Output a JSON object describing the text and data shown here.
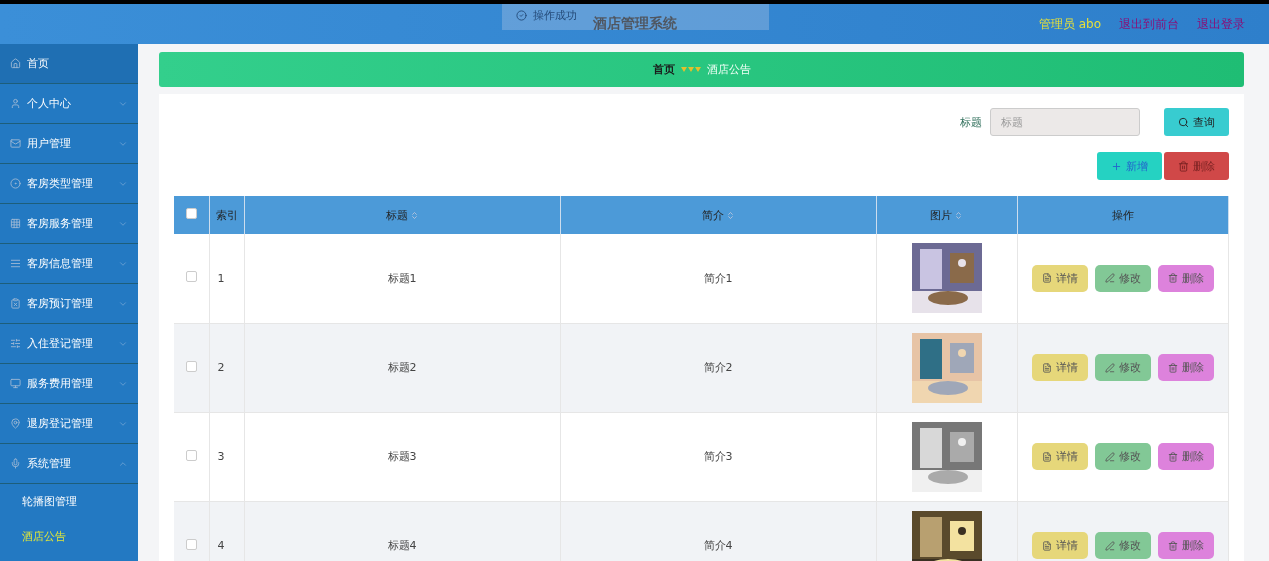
{
  "toast": {
    "text": "操作成功"
  },
  "header": {
    "title": "酒店管理系统",
    "user": "管理员 abo",
    "links": [
      "退出到前台",
      "退出登录"
    ]
  },
  "sidebar": {
    "items": [
      {
        "label": "首页"
      },
      {
        "label": "个人中心",
        "expanded": false
      },
      {
        "label": "用户管理",
        "expanded": false
      },
      {
        "label": "客房类型管理",
        "expanded": false
      },
      {
        "label": "客房服务管理",
        "expanded": false
      },
      {
        "label": "客房信息管理",
        "expanded": false
      },
      {
        "label": "客房预订管理",
        "expanded": false
      },
      {
        "label": "入住登记管理",
        "expanded": false
      },
      {
        "label": "服务费用管理",
        "expanded": false
      },
      {
        "label": "退房登记管理",
        "expanded": false
      },
      {
        "label": "系统管理",
        "expanded": true,
        "children": [
          {
            "label": "轮播图管理",
            "selected": false
          },
          {
            "label": "酒店公告",
            "selected": true
          }
        ]
      }
    ]
  },
  "breadcrumb": {
    "items": [
      "首页",
      "酒店公告"
    ]
  },
  "search": {
    "label": "标题",
    "placeholder": "标题",
    "button": "查询"
  },
  "actions": {
    "add": "新增",
    "delete": "删除"
  },
  "table": {
    "all_checked": false,
    "columns": [
      {
        "label": "索引",
        "sortable": false
      },
      {
        "label": "标题",
        "sortable": true
      },
      {
        "label": "简介",
        "sortable": true
      },
      {
        "label": "图片",
        "sortable": true
      },
      {
        "label": "操作",
        "sortable": false
      }
    ],
    "rows": [
      {
        "checked": false,
        "index": "1",
        "title": "标题1",
        "intro": "简介1",
        "buttons": [
          "详情",
          "修改",
          "删除"
        ]
      },
      {
        "checked": false,
        "index": "2",
        "title": "标题2",
        "intro": "简介2",
        "buttons": [
          "详情",
          "修改",
          "删除"
        ]
      },
      {
        "checked": false,
        "index": "3",
        "title": "标题3",
        "intro": "简介3",
        "buttons": [
          "详情",
          "修改",
          "删除"
        ]
      },
      {
        "checked": false,
        "index": "4",
        "title": "标题4",
        "intro": "简介4",
        "buttons": [
          "详情",
          "修改",
          "删除"
        ]
      }
    ]
  }
}
